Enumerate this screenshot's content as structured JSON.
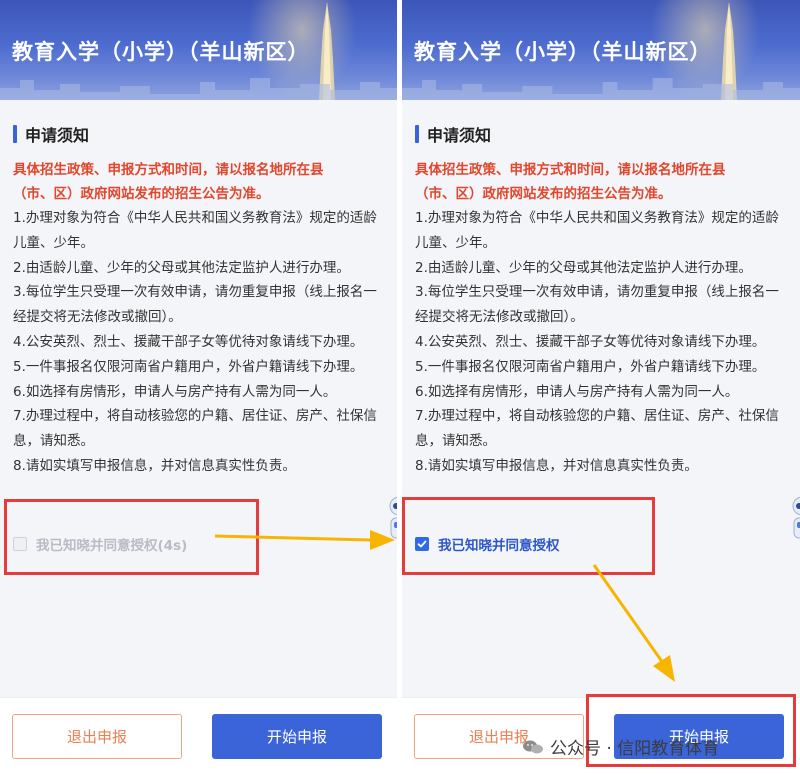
{
  "left_panel": {
    "header_title": "教育入学（小学）（羊山新区）",
    "section_title": "申请须知",
    "notice_red": [
      "具体招生政策、申报方式和时间，请以报名地所在县",
      "（市、区）政府网站发布的招生公告为准。"
    ],
    "rules": [
      "1.办理对象为符合《中华人民共和国义务教育法》规定的适龄儿童、少年。",
      "2.由适龄儿童、少年的父母或其他法定监护人进行办理。",
      "3.每位学生只受理一次有效申请，请勿重复申报（线上报名一经提交将无法修改或撤回）。",
      "4.公安英烈、烈士、援藏干部子女等优待对象请线下办理。",
      "5.一件事报名仅限河南省户籍用户，外省户籍请线下办理。",
      "6.如选择有房情形，申请人与房产持有人需为同一人。",
      "7.办理过程中，将自动核验您的户籍、居住证、房产、社保信息，请知悉。",
      "8.请如实填写申报信息，并对信息真实性负责。"
    ],
    "consent_label": "我已知晓并同意授权(4s)",
    "consent_checked": false,
    "exit_button": "退出申报",
    "start_button": "开始申报"
  },
  "right_panel": {
    "header_title": "教育入学（小学）（羊山新区）",
    "section_title": "申请须知",
    "notice_red": [
      "具体招生政策、申报方式和时间，请以报名地所在县",
      "（市、区）政府网站发布的招生公告为准。"
    ],
    "rules": [
      "1.办理对象为符合《中华人民共和国义务教育法》规定的适龄儿童、少年。",
      "2.由适龄儿童、少年的父母或其他法定监护人进行办理。",
      "3.每位学生只受理一次有效申请，请勿重复申报（线上报名一经提交将无法修改或撤回）。",
      "4.公安英烈、烈士、援藏干部子女等优待对象请线下办理。",
      "5.一件事报名仅限河南省户籍用户，外省户籍请线下办理。",
      "6.如选择有房情形，申请人与房产持有人需为同一人。",
      "7.办理过程中，将自动核验您的户籍、居住证、房产、社保信息，请知悉。",
      "8.请如实填写申报信息，并对信息真实性负责。"
    ],
    "consent_label": "我已知晓并同意授权",
    "consent_checked": true,
    "exit_button": "退出申报",
    "start_button": "开始申报"
  },
  "watermark": "公众号 · 信阳教育体育",
  "colors": {
    "accent_blue": "#3a64d8",
    "notice_red": "#e2462c",
    "annotation_red": "#e63b3b",
    "annotation_arrow": "#f7b500"
  }
}
